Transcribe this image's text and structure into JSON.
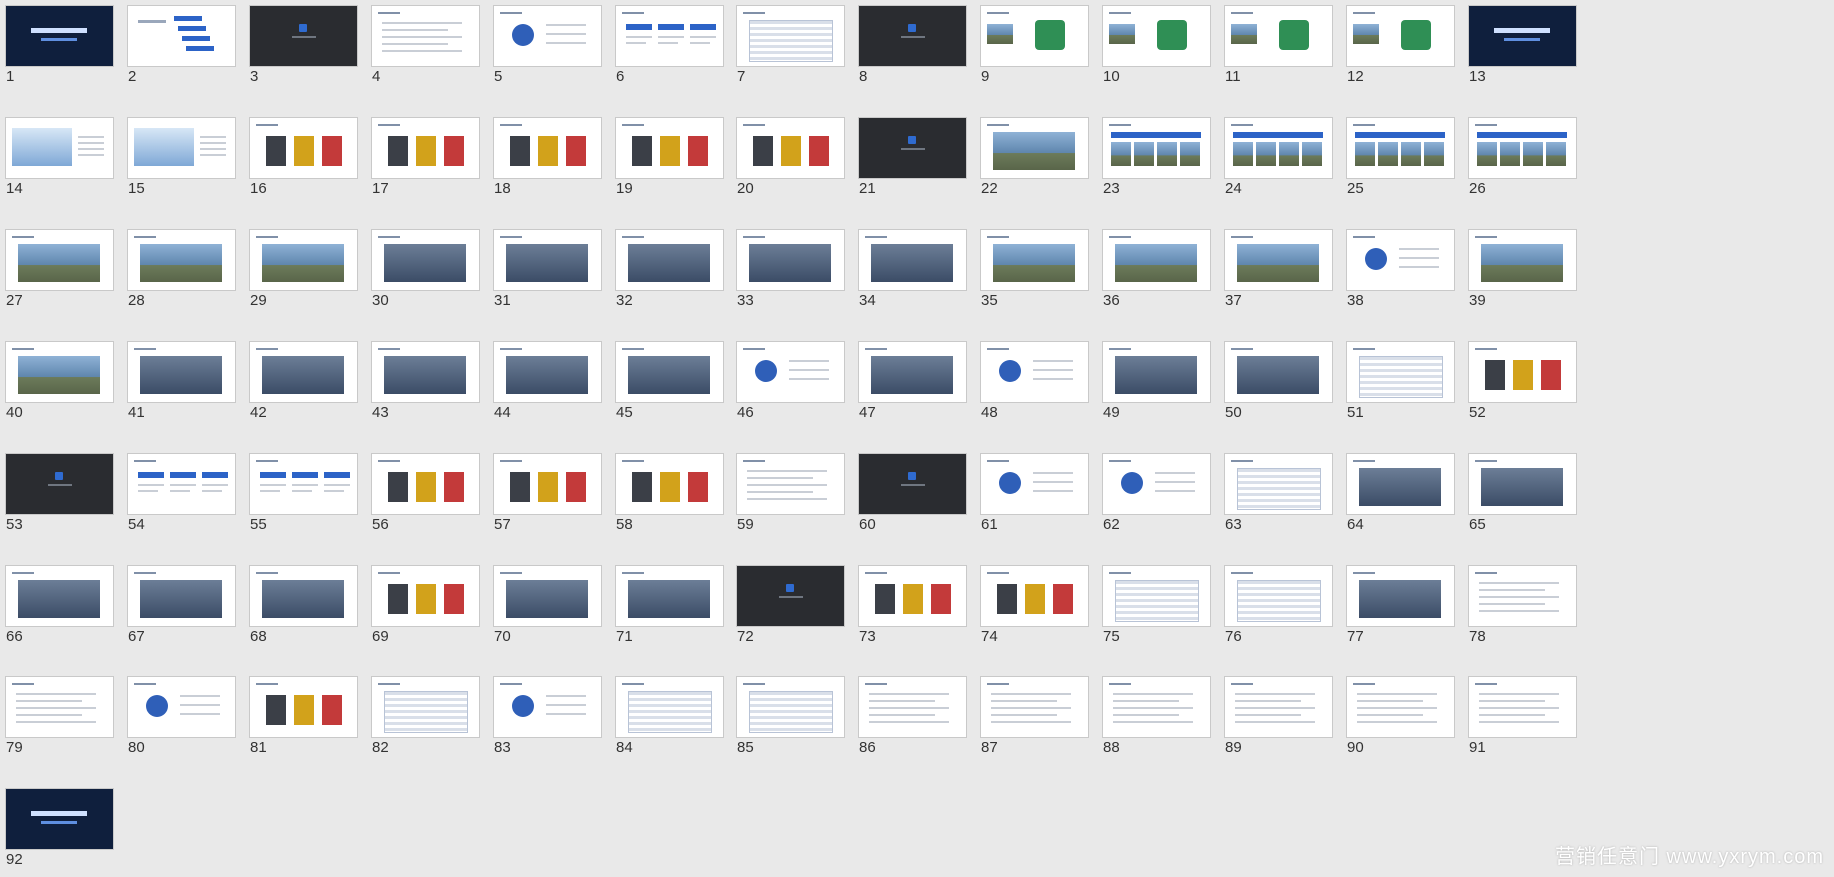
{
  "watermark": "营销任意门 www.yxrym.com",
  "slides": [
    {
      "n": "1",
      "kind": "cover"
    },
    {
      "n": "2",
      "kind": "content"
    },
    {
      "n": "3",
      "kind": "section"
    },
    {
      "n": "4",
      "kind": "text"
    },
    {
      "n": "5",
      "kind": "figure"
    },
    {
      "n": "6",
      "kind": "boxes"
    },
    {
      "n": "7",
      "kind": "table"
    },
    {
      "n": "8",
      "kind": "section"
    },
    {
      "n": "9",
      "kind": "logo"
    },
    {
      "n": "10",
      "kind": "logo"
    },
    {
      "n": "11",
      "kind": "logo"
    },
    {
      "n": "12",
      "kind": "logo"
    },
    {
      "n": "13",
      "kind": "cover"
    },
    {
      "n": "14",
      "kind": "banner"
    },
    {
      "n": "15",
      "kind": "banner"
    },
    {
      "n": "16",
      "kind": "product"
    },
    {
      "n": "17",
      "kind": "product"
    },
    {
      "n": "18",
      "kind": "product"
    },
    {
      "n": "19",
      "kind": "product"
    },
    {
      "n": "20",
      "kind": "product"
    },
    {
      "n": "21",
      "kind": "section"
    },
    {
      "n": "22",
      "kind": "photo"
    },
    {
      "n": "23",
      "kind": "gallery"
    },
    {
      "n": "24",
      "kind": "gallery"
    },
    {
      "n": "25",
      "kind": "gallery"
    },
    {
      "n": "26",
      "kind": "gallery"
    },
    {
      "n": "27",
      "kind": "photo"
    },
    {
      "n": "28",
      "kind": "photo"
    },
    {
      "n": "29",
      "kind": "photo"
    },
    {
      "n": "30",
      "kind": "indoor"
    },
    {
      "n": "31",
      "kind": "indoor"
    },
    {
      "n": "32",
      "kind": "indoor"
    },
    {
      "n": "33",
      "kind": "indoor"
    },
    {
      "n": "34",
      "kind": "indoor"
    },
    {
      "n": "35",
      "kind": "photo"
    },
    {
      "n": "36",
      "kind": "photo"
    },
    {
      "n": "37",
      "kind": "photo"
    },
    {
      "n": "38",
      "kind": "figure"
    },
    {
      "n": "39",
      "kind": "photo"
    },
    {
      "n": "40",
      "kind": "photo"
    },
    {
      "n": "41",
      "kind": "indoor"
    },
    {
      "n": "42",
      "kind": "indoor"
    },
    {
      "n": "43",
      "kind": "indoor"
    },
    {
      "n": "44",
      "kind": "indoor"
    },
    {
      "n": "45",
      "kind": "indoor"
    },
    {
      "n": "46",
      "kind": "figure"
    },
    {
      "n": "47",
      "kind": "indoor"
    },
    {
      "n": "48",
      "kind": "figure"
    },
    {
      "n": "49",
      "kind": "indoor"
    },
    {
      "n": "50",
      "kind": "indoor"
    },
    {
      "n": "51",
      "kind": "table"
    },
    {
      "n": "52",
      "kind": "product"
    },
    {
      "n": "53",
      "kind": "section"
    },
    {
      "n": "54",
      "kind": "boxes"
    },
    {
      "n": "55",
      "kind": "boxes"
    },
    {
      "n": "56",
      "kind": "product"
    },
    {
      "n": "57",
      "kind": "product"
    },
    {
      "n": "58",
      "kind": "product"
    },
    {
      "n": "59",
      "kind": "text"
    },
    {
      "n": "60",
      "kind": "section"
    },
    {
      "n": "61",
      "kind": "figure"
    },
    {
      "n": "62",
      "kind": "figure"
    },
    {
      "n": "63",
      "kind": "table"
    },
    {
      "n": "64",
      "kind": "indoor"
    },
    {
      "n": "65",
      "kind": "indoor"
    },
    {
      "n": "66",
      "kind": "indoor"
    },
    {
      "n": "67",
      "kind": "indoor"
    },
    {
      "n": "68",
      "kind": "indoor"
    },
    {
      "n": "69",
      "kind": "product"
    },
    {
      "n": "70",
      "kind": "indoor"
    },
    {
      "n": "71",
      "kind": "indoor"
    },
    {
      "n": "72",
      "kind": "section"
    },
    {
      "n": "73",
      "kind": "product"
    },
    {
      "n": "74",
      "kind": "product"
    },
    {
      "n": "75",
      "kind": "table"
    },
    {
      "n": "76",
      "kind": "table"
    },
    {
      "n": "77",
      "kind": "indoor"
    },
    {
      "n": "78",
      "kind": "text"
    },
    {
      "n": "79",
      "kind": "text"
    },
    {
      "n": "80",
      "kind": "figure"
    },
    {
      "n": "81",
      "kind": "product"
    },
    {
      "n": "82",
      "kind": "table"
    },
    {
      "n": "83",
      "kind": "figure"
    },
    {
      "n": "84",
      "kind": "table"
    },
    {
      "n": "85",
      "kind": "table"
    },
    {
      "n": "86",
      "kind": "text"
    },
    {
      "n": "87",
      "kind": "text"
    },
    {
      "n": "88",
      "kind": "text"
    },
    {
      "n": "89",
      "kind": "text"
    },
    {
      "n": "90",
      "kind": "text"
    },
    {
      "n": "91",
      "kind": "text"
    },
    {
      "n": "92",
      "kind": "cover"
    }
  ]
}
